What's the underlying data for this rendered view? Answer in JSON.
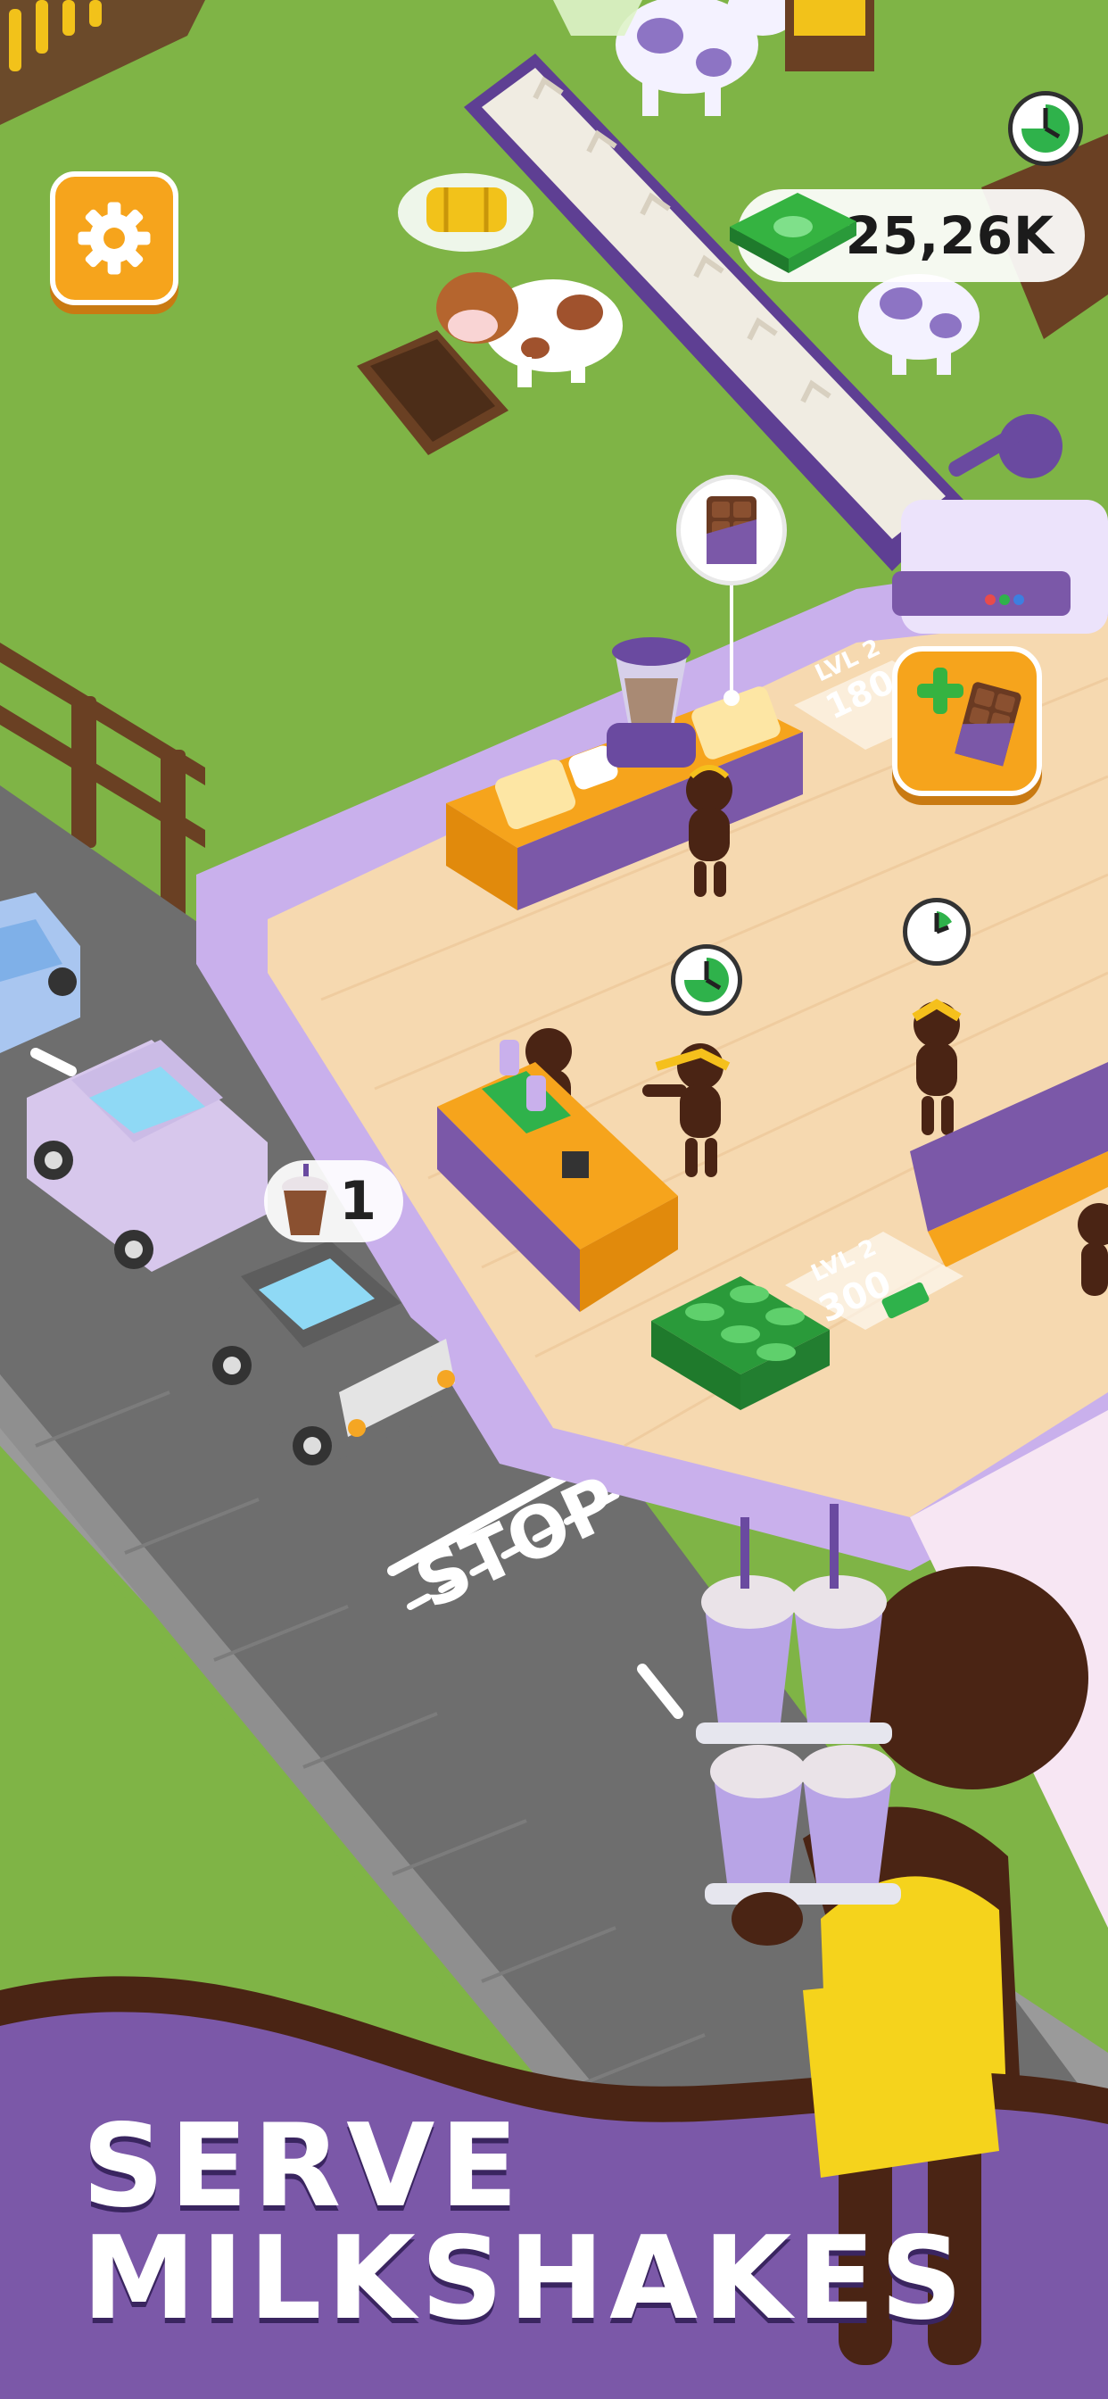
{
  "hud": {
    "money_value": "25,26K",
    "money_icon": "cash-stack-icon",
    "settings_icon": "gear-icon",
    "timer_icon": "clock-icon"
  },
  "upgrade": {
    "icon": "chocolate-bar-icon",
    "plus_icon": "plus-icon"
  },
  "stations": [
    {
      "label": "LVL 2",
      "value": "180"
    },
    {
      "label": "LVL 2",
      "value": "300"
    }
  ],
  "bubbles": {
    "ingredient_icon": "chocolate-bar-icon",
    "hay_icon": "hay-bale-icon",
    "customer_order_count": "1",
    "customer_order_icon": "milkshake-cup-icon"
  },
  "road": {
    "stop_text": "STOP"
  },
  "promo": {
    "line1": "SERVE",
    "line2": "MILKSHAKES"
  },
  "colors": {
    "grass": "#7fb446",
    "road": "#707070",
    "floor": "#f6d9b0",
    "accent_orange": "#f6a41c",
    "purple": "#7b58a8",
    "money_green": "#35b341"
  }
}
